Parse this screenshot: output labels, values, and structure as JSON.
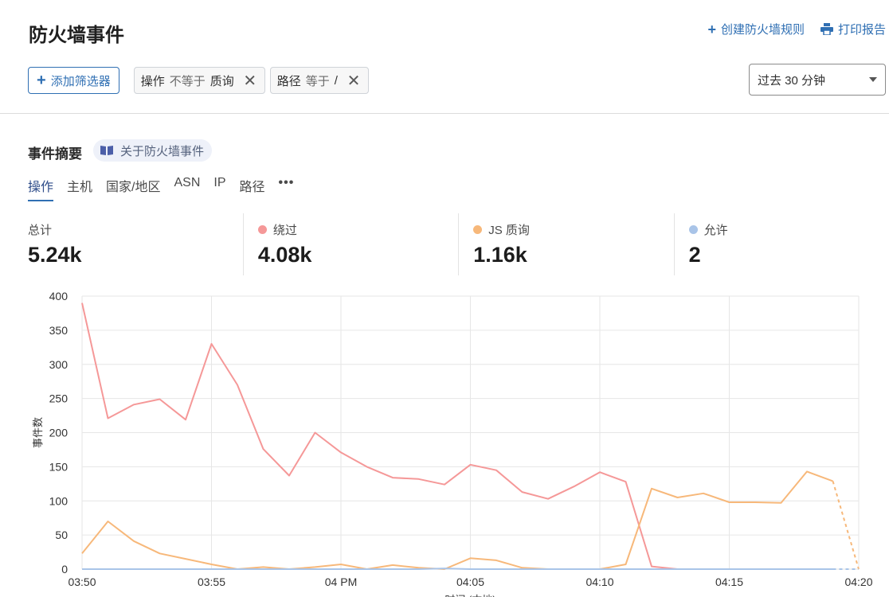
{
  "header": {
    "title": "防火墙事件",
    "create_rule_label": "创建防火墙规则",
    "print_report_label": "打印报告"
  },
  "filters": {
    "add_filter_label": "添加筛选器",
    "chips": [
      {
        "field": "操作",
        "operator": "不等于",
        "value": "质询"
      },
      {
        "field": "路径",
        "operator": "等于",
        "value": "/"
      }
    ]
  },
  "time_range": {
    "selected": "过去 30 分钟"
  },
  "summary": {
    "title": "事件摘要",
    "about_label": "关于防火墙事件",
    "tabs": [
      "操作",
      "主机",
      "国家/地区",
      "ASN",
      "IP",
      "路径"
    ],
    "active_tab": "操作"
  },
  "stats": [
    {
      "label": "总计",
      "value": "5.24k",
      "color": ""
    },
    {
      "label": "绕过",
      "value": "4.08k",
      "color": "#f59898"
    },
    {
      "label": "JS 质询",
      "value": "1.16k",
      "color": "#f7b87a"
    },
    {
      "label": "允许",
      "value": "2",
      "color": "#a9c4e8"
    }
  ],
  "chart_data": {
    "type": "line",
    "ylabel": "事件数",
    "xlabel": "时间 (本地)",
    "ylim": [
      0,
      400
    ],
    "yticks": [
      0,
      50,
      100,
      150,
      200,
      250,
      300,
      350,
      400
    ],
    "xticks": [
      "03:50",
      "03:55",
      "04 PM",
      "04:05",
      "04:10",
      "04:15",
      "04:20"
    ],
    "x_minutes": [
      0,
      1,
      2,
      3,
      4,
      5,
      6,
      7,
      8,
      9,
      10,
      11,
      12,
      13,
      14,
      15,
      16,
      17,
      18,
      19,
      20,
      21,
      22,
      23,
      24,
      25,
      26,
      27,
      28,
      29,
      30
    ],
    "grid": true,
    "series": [
      {
        "name": "绕过",
        "color": "#f59898",
        "values": [
          390,
          221,
          241,
          249,
          219,
          330,
          270,
          176,
          137,
          200,
          171,
          150,
          134,
          132,
          124,
          153,
          145,
          113,
          103,
          121,
          142,
          128,
          4,
          0,
          0,
          0,
          0,
          0,
          0,
          0,
          0
        ],
        "dashed_from": 29
      },
      {
        "name": "JS 质询",
        "color": "#f7b87a",
        "values": [
          23,
          70,
          41,
          23,
          15,
          7,
          0,
          3,
          0,
          3,
          7,
          0,
          6,
          2,
          0,
          16,
          13,
          2,
          0,
          0,
          0,
          7,
          118,
          105,
          111,
          98,
          98,
          97,
          143,
          129,
          0
        ],
        "dashed_from": 29
      },
      {
        "name": "允许",
        "color": "#a9c4e8",
        "values": [
          0,
          0,
          0,
          0,
          0,
          0,
          0,
          0,
          0,
          0,
          0,
          0,
          0,
          0,
          1,
          0,
          0,
          0,
          0,
          0,
          0,
          0,
          0,
          0,
          0,
          0,
          0,
          0,
          0,
          0,
          0
        ],
        "dashed_from": 29
      }
    ]
  }
}
